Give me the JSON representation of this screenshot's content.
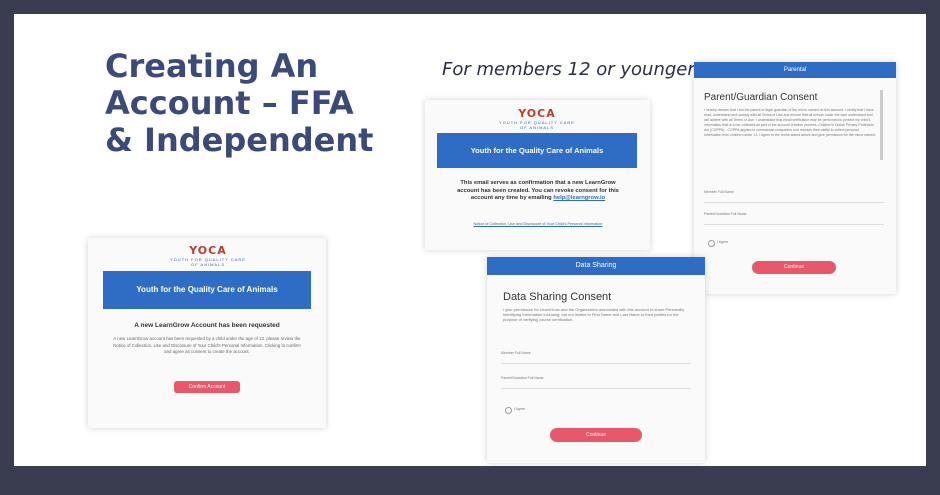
{
  "slide": {
    "title": "Creating An Account – FFA & Independent",
    "subtitle": "For members 12 or younger"
  },
  "logo": {
    "name": "YOCA",
    "tagline": "YOUTH FOR QUALITY CARE OF ANIMALS"
  },
  "card_request": {
    "banner": "Youth for the Quality Care of Animals",
    "heading": "A new LearnGrow Account has been requested",
    "body": "A new LearnGrow account has been requested by a child under the age of 13. please review the Notice of Collection, Use and Disclosure of Your Child's Personal Information. Clicking to confirm and agree as consent to create the account.",
    "button": "Confirm Account"
  },
  "card_email": {
    "banner": "Youth for the Quality Care of Animals",
    "body": "This email serves as confirmation that a new LearnGrow account has been created. You can revoke consent for this account any time by emailing",
    "email": "help@learngrow.io",
    "link": "Notice of Collection, Use and Disclosure of Your Child's Personal Information"
  },
  "card_parental": {
    "header": "Parental",
    "heading": "Parent/Guardian Consent",
    "body": "I hereby declare that I am the parent or legal guardian of the minor named on this account. I certify that I have read, understand and comply with all Terms of Use and ensure that all minors under the care understand and will adhere with all Terms of Use. I understand that email verification may be performed to protect my child's information that is to be collected as part of the account creation process. Children's Online Privacy Protection Act (COPPA) - COPPA applies to commercial companies and restricts their ability to collect personal information from children under 13. I agree to the terms stated above and give permission for the minor named.",
    "field1": "Member Full Name",
    "field2": "Parent/Guardian Full Name",
    "agree": "I Agree",
    "button": "Continue"
  },
  "card_sharing": {
    "header": "Data Sharing",
    "heading": "Data Sharing Consent",
    "body": "I give permission for LearnGrow and the Organization associated with this account to share Personally Identifying Information including, but not limited to First Name and Last Name to third parties for the purpose of verifying course certification.",
    "field1": "Member Full Name",
    "field2": "Parent/Guardian Full Name",
    "agree": "I Agree",
    "button": "Continue"
  },
  "colors": {
    "title": "#3a4a7a",
    "banner": "#2f6cc4",
    "button": "#e8576a",
    "frame": "#3a3d4f"
  }
}
